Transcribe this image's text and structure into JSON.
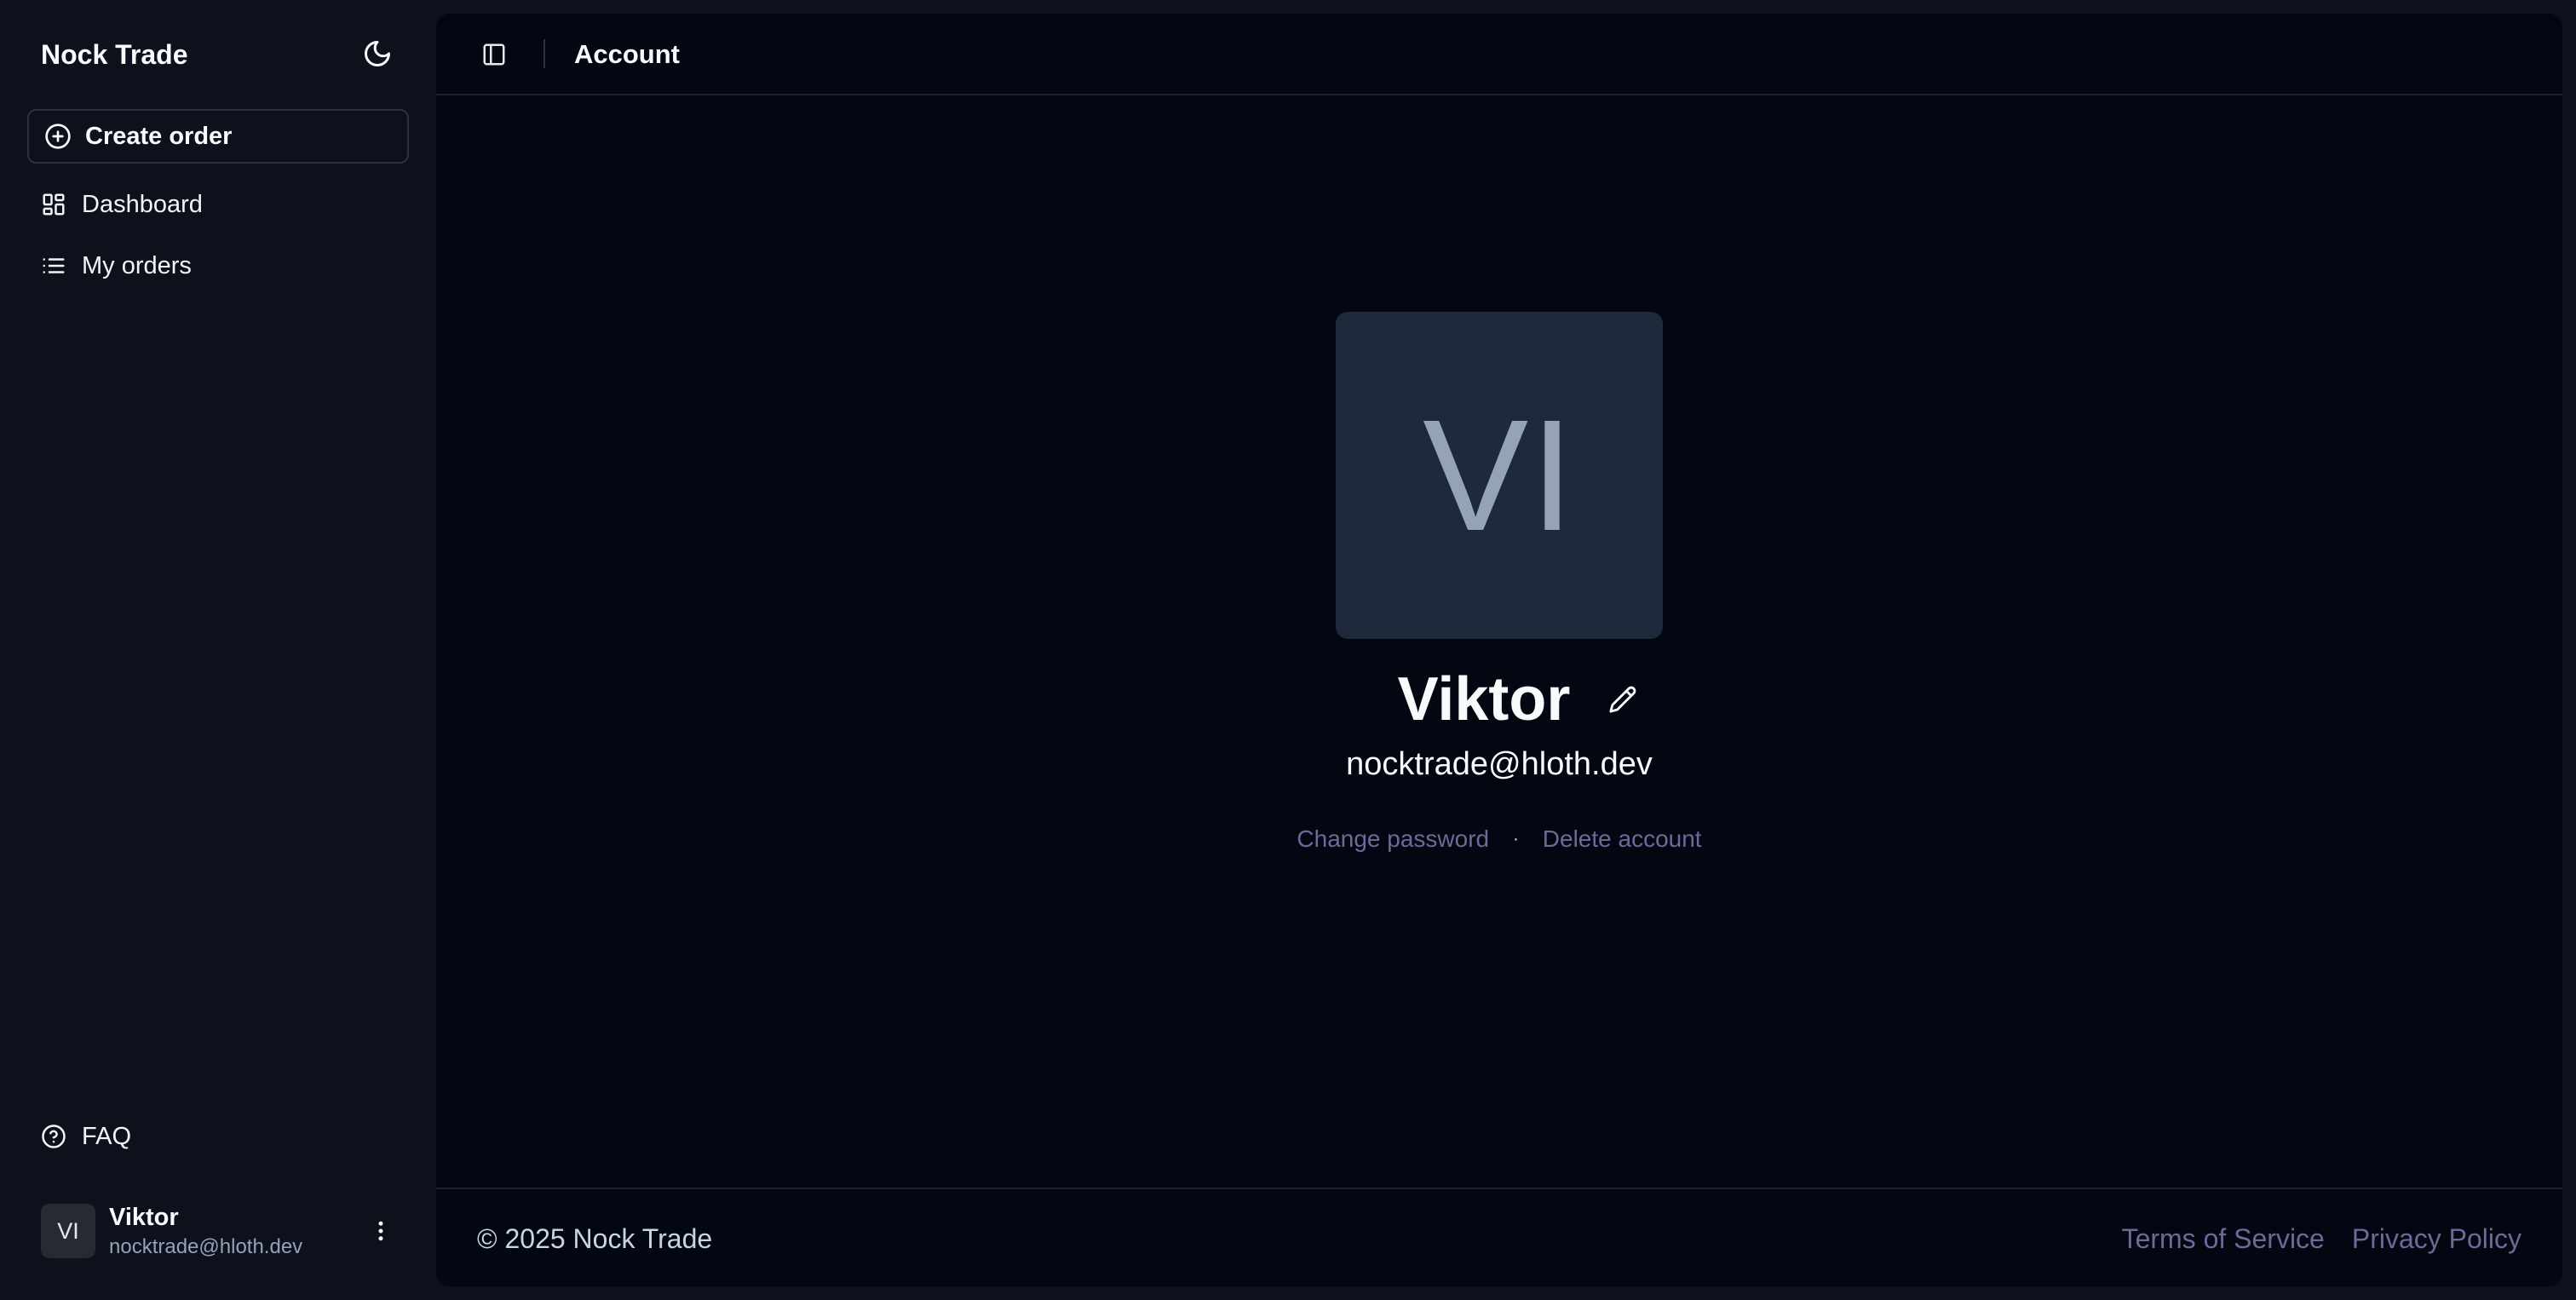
{
  "sidebar": {
    "brand": "Nock Trade",
    "theme_icon": "moon-icon",
    "create_order": "Create order",
    "nav": {
      "dashboard": "Dashboard",
      "my_orders": "My orders",
      "faq": "FAQ"
    },
    "user": {
      "initials": "VI",
      "name": "Viktor",
      "email": "nocktrade@hloth.dev"
    }
  },
  "header": {
    "title": "Account"
  },
  "profile": {
    "initials": "VI",
    "name": "Viktor",
    "email": "nocktrade@hloth.dev",
    "change_password": "Change password",
    "separator": "·",
    "delete_account": "Delete account"
  },
  "footer": {
    "copyright": "© 2025 Nock Trade",
    "terms": "Terms of Service",
    "privacy": "Privacy Policy"
  },
  "colors": {
    "sidebar_bg": "#0c111c",
    "main_bg": "#020712",
    "avatar_bg": "#1e293b",
    "muted_link": "#6b6b98"
  }
}
